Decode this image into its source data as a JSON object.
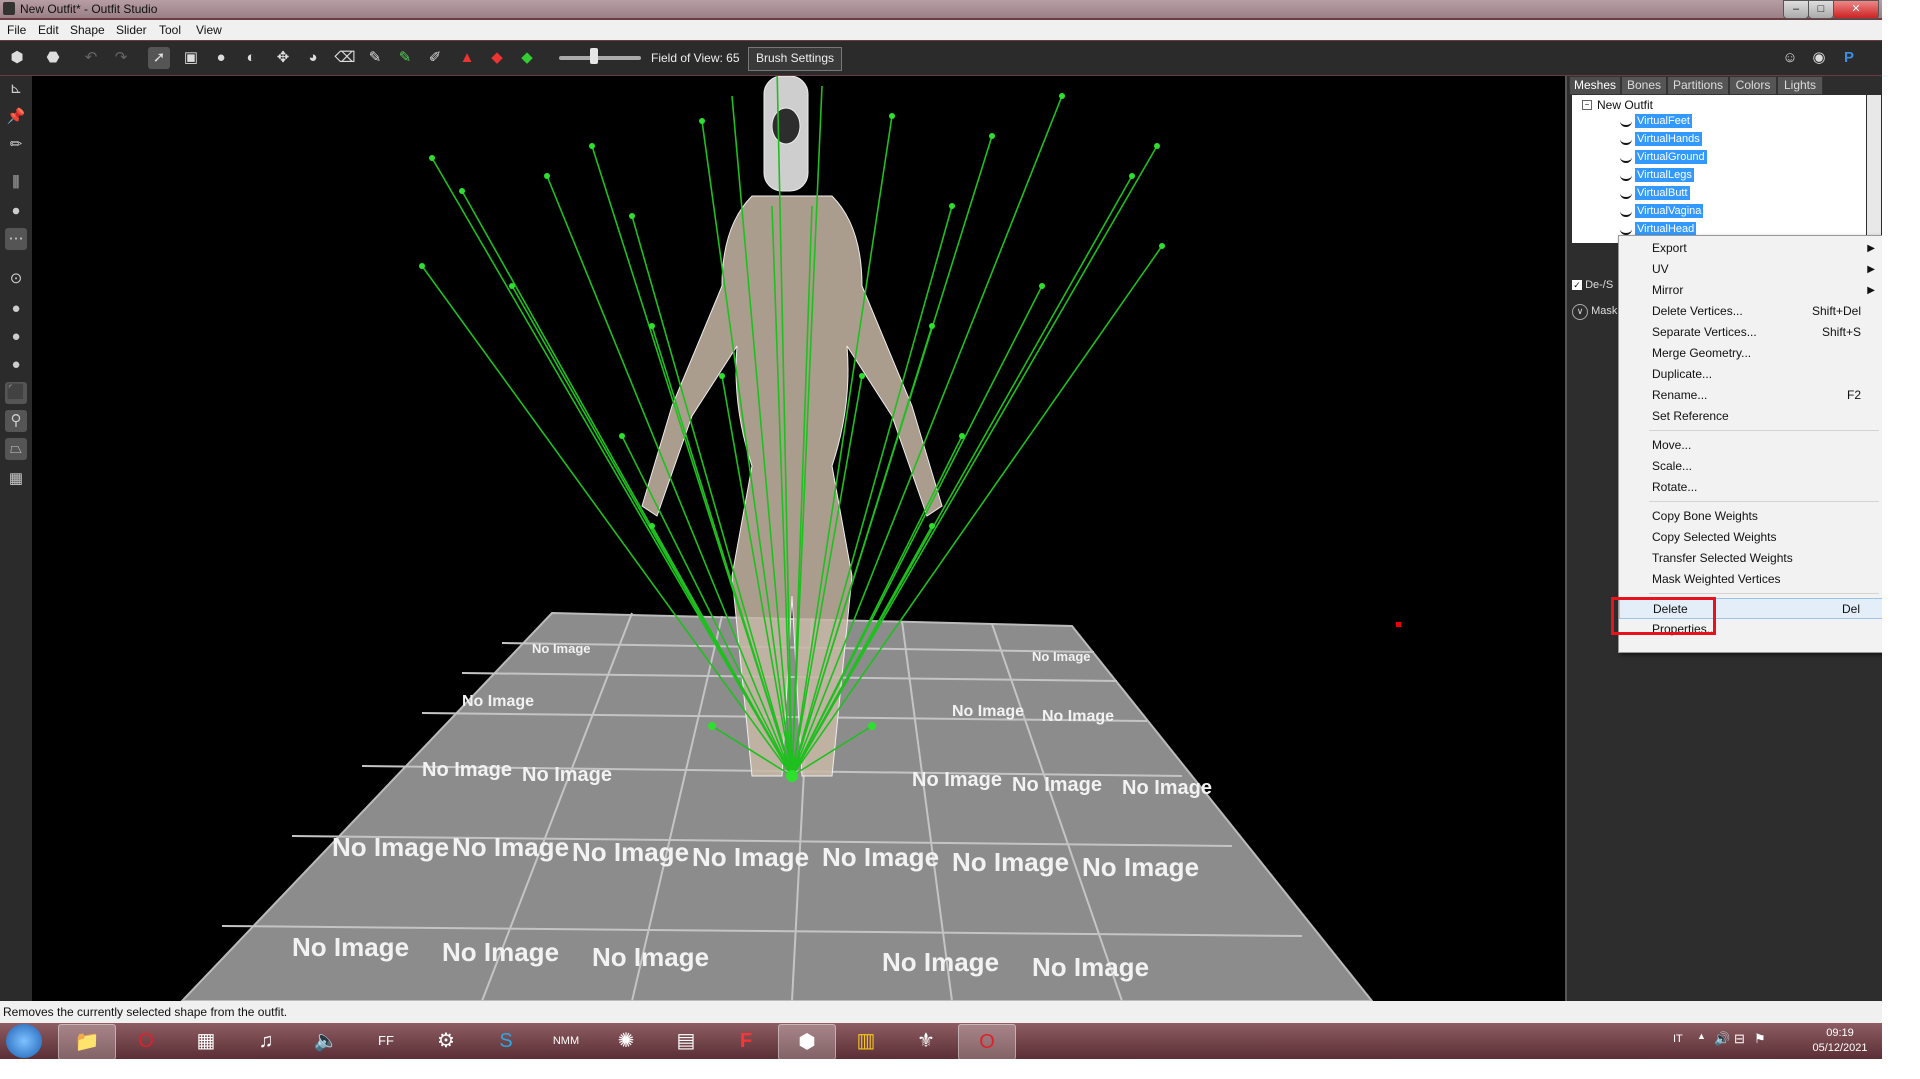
{
  "window": {
    "title": "New Outfit* - Outfit Studio",
    "controls": {
      "minimize": "–",
      "maximize": "□",
      "close": "✕"
    }
  },
  "menubar": [
    "File",
    "Edit",
    "Shape",
    "Slider",
    "Tool",
    "View"
  ],
  "toolbar": {
    "fov_label": "Field of View: 65",
    "fov_value": 65,
    "brush_settings": "Brush Settings"
  },
  "viewport": {
    "ground_tile_text": "No Image"
  },
  "panel": {
    "tabs": [
      "Meshes",
      "Bones",
      "Partitions",
      "Colors",
      "Lights"
    ],
    "tree_root": "New Outfit",
    "tree_items": [
      "VirtualFeet",
      "VirtualHands",
      "VirtualGround",
      "VirtualLegs",
      "VirtualButt",
      "VirtualVagina",
      "VirtualHead"
    ],
    "deselect_label": "De-/S",
    "mask_label": "Mask"
  },
  "context_menu": [
    {
      "label": "Export",
      "submenu": true
    },
    {
      "label": "UV",
      "submenu": true
    },
    {
      "label": "Mirror",
      "submenu": true
    },
    {
      "label": "Delete Vertices...",
      "shortcut": "Shift+Del"
    },
    {
      "label": "Separate Vertices...",
      "shortcut": "Shift+S"
    },
    {
      "label": "Merge Geometry..."
    },
    {
      "label": "Duplicate..."
    },
    {
      "label": "Rename...",
      "shortcut": "F2"
    },
    {
      "label": "Set Reference"
    },
    {
      "label": "Move..."
    },
    {
      "label": "Scale..."
    },
    {
      "label": "Rotate..."
    },
    {
      "label": "Copy Bone Weights"
    },
    {
      "label": "Copy Selected Weights"
    },
    {
      "label": "Transfer Selected Weights"
    },
    {
      "label": "Mask Weighted Vertices"
    },
    {
      "label": "Delete",
      "shortcut": "Del"
    },
    {
      "label": "Properties..."
    }
  ],
  "statusbar": "Removes the currently selected shape from the outfit.",
  "taskbar": {
    "language": "IT",
    "time": "09:19",
    "date": "05/12/2021"
  },
  "colors": {
    "selection": "#3399ff",
    "highlight_box": "#e8121e",
    "bone_lines": "#1fbf1f"
  }
}
